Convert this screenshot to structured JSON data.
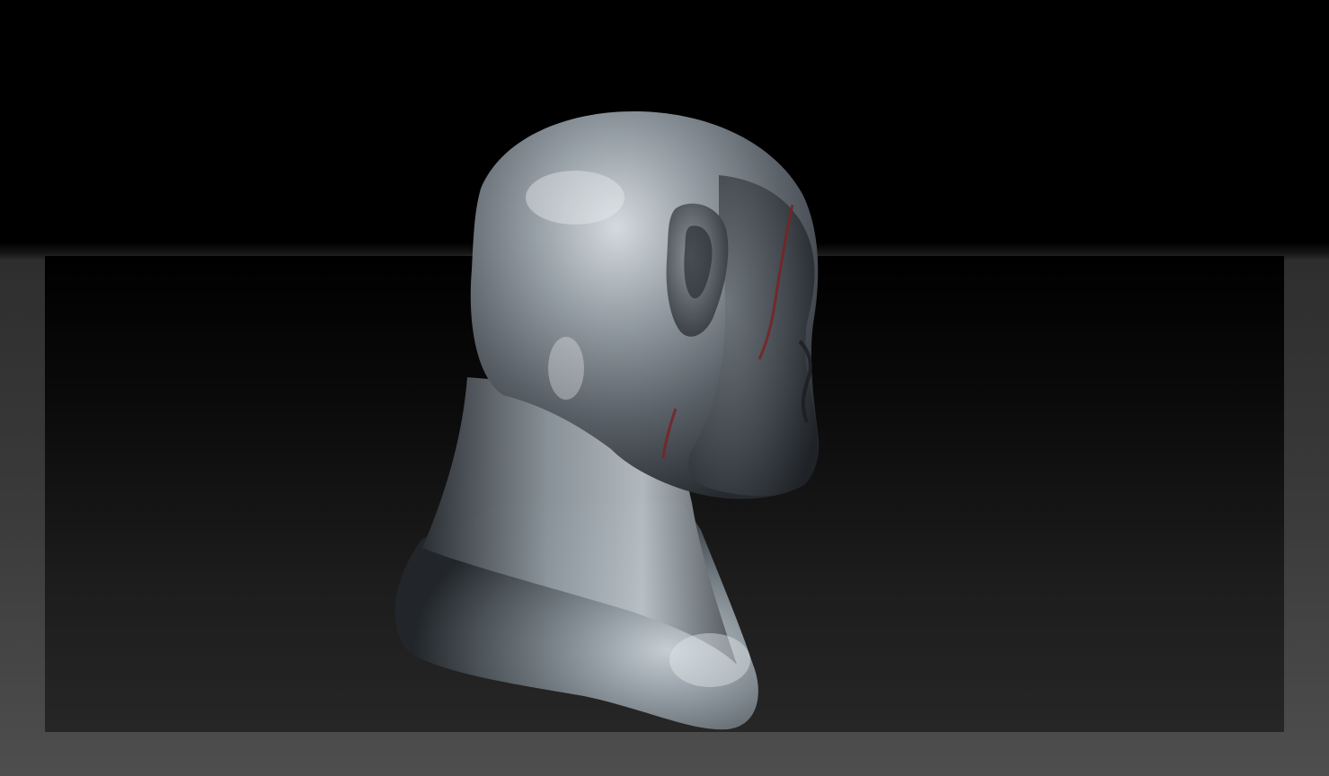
{
  "scene": {
    "subject": "",
    "colors": {
      "background_top": "#000000",
      "background_bottom": "#4e4e4e",
      "canvas": "#1a1a1a",
      "material_light": "#c9d0d6",
      "material_mid": "#7d858d",
      "material_dark": "#2d3237",
      "scar": "#7a2222"
    }
  }
}
